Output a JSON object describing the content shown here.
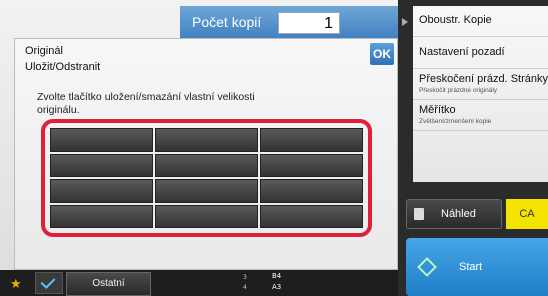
{
  "header": {
    "copies_label": "Počet kopií",
    "copies_value": "1"
  },
  "right_menu": {
    "items": [
      {
        "label": "Oboustr. Kopie",
        "sub": ""
      },
      {
        "label": "Nastavení pozadí",
        "sub": ""
      },
      {
        "label": "Přeskočení prázd. Stránky",
        "sub": "Přeskočit prázdné originály"
      },
      {
        "label": "Měřítko",
        "sub": "Zvětšení/zmenšení kopie"
      }
    ],
    "preview_label": "Náhled",
    "ca_label": "CA",
    "start_label": "Start"
  },
  "bottom": {
    "other_label": "Ostatní",
    "trays": [
      {
        "num": "3",
        "size": "B4"
      },
      {
        "num": "4",
        "size": "A3"
      }
    ]
  },
  "dialog": {
    "title": "Originál",
    "subtitle": "Uložit/Odstranit",
    "ok_label": "OK",
    "instruction": "Zvolte tlačítko uložení/smazání vlastní velikosti originálu.",
    "grid": {
      "rows": 4,
      "cols": 3
    }
  },
  "colors": {
    "accent_blue": "#3f7fc0",
    "highlight_red": "#e0203a",
    "ca_yellow": "#f2e400"
  }
}
